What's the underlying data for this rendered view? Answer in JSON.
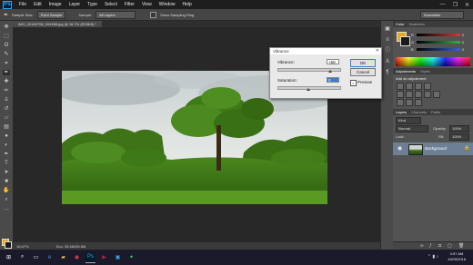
{
  "menubar": {
    "logo": "Ps",
    "items": [
      "File",
      "Edit",
      "Image",
      "Layer",
      "Type",
      "Select",
      "Filter",
      "View",
      "Window",
      "Help"
    ],
    "min": "—",
    "max": "❐",
    "close": "✕"
  },
  "options": {
    "sample_size_label": "Sample Size:",
    "sample_size_value": "Point Sample",
    "sample_label": "Sample:",
    "sample_value": "All Layers",
    "show_ring": "Show Sampling Ring",
    "workspace": "Essentials"
  },
  "document": {
    "tab": "IMG_20160708_091658.jpg @ 16.7% (RGB/8) *"
  },
  "status": {
    "zoom": "16.67%",
    "doc": "Doc: 35.6M/35.6M"
  },
  "panels": {
    "color_tabs": [
      "Color",
      "Swatches"
    ],
    "adjust_tabs": [
      "Adjustments",
      "Styles"
    ],
    "add_adjustment": "Add an adjustment",
    "layer_tabs": [
      "Layers",
      "Channels",
      "Paths"
    ],
    "kind": "Kind",
    "blend": "Normal",
    "opacity_label": "Opacity:",
    "opacity_value": "100%",
    "lock_label": "Lock:",
    "fill_label": "Fill:",
    "fill_value": "100%",
    "layer_name": "Background",
    "sliders": [
      {
        "label": "R",
        "value": "0",
        "color": "#d23a3a"
      },
      {
        "label": "G",
        "value": "0",
        "color": "#3ab04a"
      },
      {
        "label": "B",
        "value": "0",
        "color": "#3a5fd2"
      }
    ]
  },
  "dialog": {
    "title": "Vibrance",
    "vibrance_label": "Vibrance:",
    "vibrance_value": "+69",
    "saturation_label": "Saturation:",
    "saturation_value": "0",
    "ok": "OK",
    "cancel": "Cancel",
    "preview_label": "Preview",
    "vibrance_level": 0.85,
    "saturation_level": 0.5
  },
  "taskbar": {
    "time": "3:57 AM",
    "date": "10/09/2016"
  },
  "colors": {
    "accent": "#2fa3f7",
    "foreground": "#e8a820",
    "background": "#1a1a1a"
  }
}
